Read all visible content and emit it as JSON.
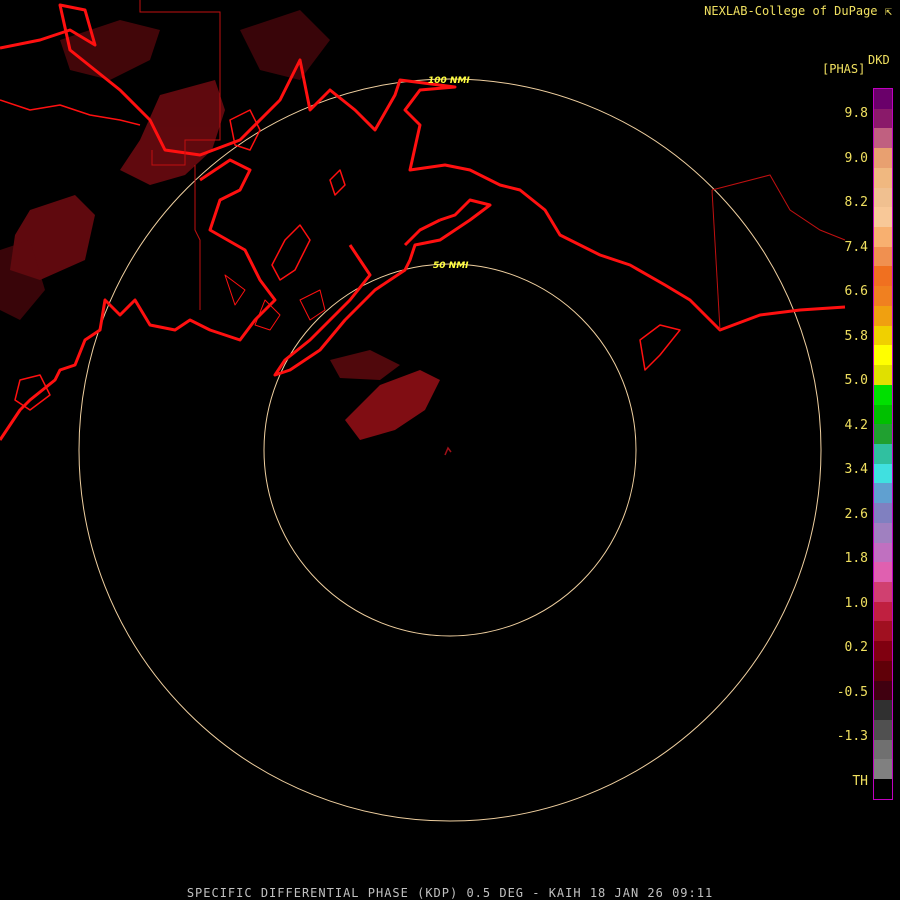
{
  "header": {
    "credit": "NEXLAB-College of DuPage",
    "credit_icon": "corner-arrow-icon"
  },
  "legend": {
    "product_code": "DKD",
    "unit": "[PHAS]",
    "ticks": [
      "9.8",
      "9.0",
      "8.2",
      "7.4",
      "6.6",
      "5.8",
      "5.0",
      "4.2",
      "3.4",
      "2.6",
      "1.8",
      "1.0",
      "0.2",
      "-0.5",
      "-1.3",
      "TH"
    ],
    "colors": [
      "#6a006a",
      "#8a1a6a",
      "#c06080",
      "#e8a070",
      "#f0b880",
      "#f0c090",
      "#f8c898",
      "#f8b070",
      "#f09050",
      "#f07020",
      "#f08020",
      "#f0a010",
      "#f0d000",
      "#ffff00",
      "#e0e000",
      "#00e000",
      "#00c000",
      "#20a030",
      "#30c0a0",
      "#40e0e0",
      "#60a0d0",
      "#8080c0",
      "#a080c0",
      "#c070c0",
      "#e060b0",
      "#d04070",
      "#c02040",
      "#a01020",
      "#800010",
      "#600008",
      "#400010",
      "#303030",
      "#505050",
      "#707070",
      "#808080",
      "#000000"
    ],
    "border_color": "#c000c0"
  },
  "map": {
    "range_rings": [
      {
        "label": "100 NMI",
        "radius_nmi": 100
      },
      {
        "label": "50 NMI",
        "radius_nmi": 50
      }
    ],
    "coast_color": "#ff1010",
    "ring_color": "#f0d0a0",
    "ring_label_color": "#ffff40",
    "echo_color": "#7a0a10"
  },
  "footer": {
    "caption": "SPECIFIC DIFFERENTIAL PHASE (KDP) 0.5 DEG - KAIH 18 JAN 26 09:11"
  }
}
